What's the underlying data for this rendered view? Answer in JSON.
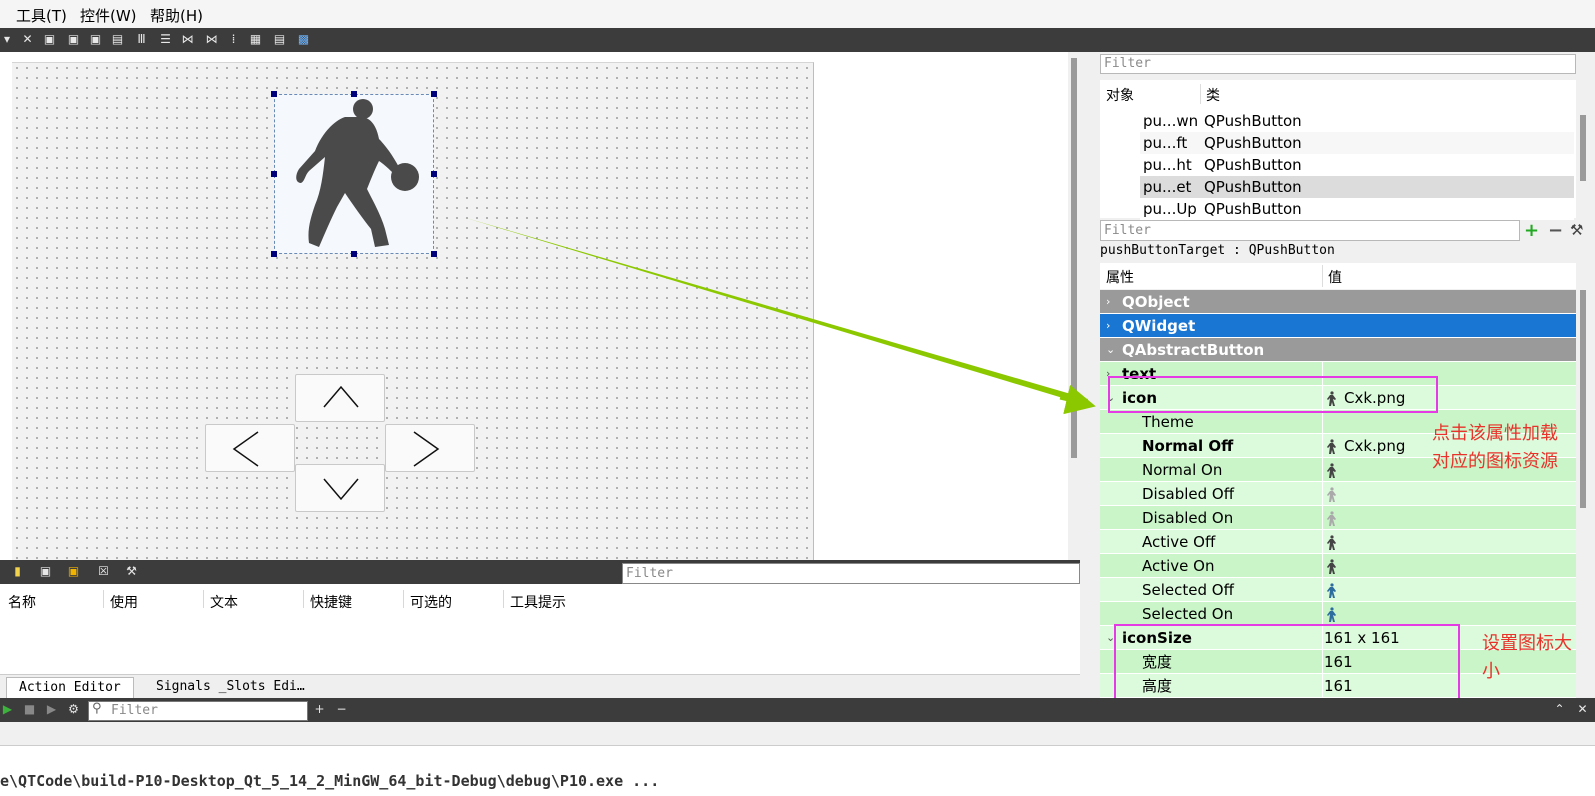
{
  "menu": {
    "items": [
      "工具(T)",
      "控件(W)",
      "帮助(H)"
    ]
  },
  "toolbar": {
    "icons": [
      "dropdown-icon",
      "break-layout-icon",
      "widget-editor-icon",
      "signal-slot-icon",
      "buddy-icon",
      "tab-order-icon",
      "layout-horizontal-icon",
      "layout-vertical-icon",
      "splitter-horizontal-icon",
      "splitter-vertical-icon",
      "layout-form-icon",
      "layout-grid-icon",
      "adjust-size-icon",
      "preview-icon"
    ]
  },
  "canvas": {
    "target_button_icon": "basketball-player-icon",
    "arrow_buttons": [
      "up-arrow-icon",
      "left-arrow-icon",
      "right-arrow-icon",
      "down-arrow-icon"
    ]
  },
  "object_inspector": {
    "filter_placeholder": "Filter",
    "col_object": "对象",
    "col_class": "类",
    "rows": [
      {
        "name": "pu...wn",
        "class": "QPushButton",
        "selected": false
      },
      {
        "name": "pu...ft",
        "class": "QPushButton",
        "selected": false
      },
      {
        "name": "pu...ht",
        "class": "QPushButton",
        "selected": false
      },
      {
        "name": "pu...et",
        "class": "QPushButton",
        "selected": true
      },
      {
        "name": "pu...Up",
        "class": "QPushButton",
        "selected": false
      }
    ]
  },
  "property_editor": {
    "filter_placeholder": "Filter",
    "object_label": "pushButtonTarget : QPushButton",
    "col_property": "属性",
    "col_value": "值",
    "rows": [
      {
        "key": "QObject",
        "value": "",
        "kind": "group",
        "color": "#9a9a9a"
      },
      {
        "key": "QWidget",
        "value": "",
        "kind": "group",
        "color": "#1976d2"
      },
      {
        "key": "QAbstractButton",
        "value": "",
        "kind": "group",
        "color": "#9a9a9a"
      },
      {
        "key": "text",
        "value": "",
        "kind": "prop-bold"
      },
      {
        "key": "icon",
        "value": "Cxk.png",
        "kind": "prop-bold"
      },
      {
        "key": "Theme",
        "value": "",
        "kind": "sub"
      },
      {
        "key": "Normal Off",
        "value": "Cxk.png",
        "kind": "sub-bold"
      },
      {
        "key": "Normal On",
        "value": "",
        "kind": "sub"
      },
      {
        "key": "Disabled Off",
        "value": "",
        "kind": "sub"
      },
      {
        "key": "Disabled On",
        "value": "",
        "kind": "sub"
      },
      {
        "key": "Active Off",
        "value": "",
        "kind": "sub"
      },
      {
        "key": "Active On",
        "value": "",
        "kind": "sub"
      },
      {
        "key": "Selected Off",
        "value": "",
        "kind": "sub"
      },
      {
        "key": "Selected On",
        "value": "",
        "kind": "sub"
      },
      {
        "key": "iconSize",
        "value": "161 x 161",
        "kind": "prop-bold"
      },
      {
        "key": "宽度",
        "value": "161",
        "kind": "sub"
      },
      {
        "key": "高度",
        "value": "161",
        "kind": "sub"
      }
    ]
  },
  "annotations": {
    "icon_note_line1": "点击该属性加载",
    "icon_note_line2": "对应的图标资源",
    "size_note_line1": "设置图标大",
    "size_note_line2": "小",
    "highlight_color": "#e43be4",
    "arrow_color": "#8cc800"
  },
  "action_editor": {
    "filter_placeholder": "Filter",
    "columns": [
      "名称",
      "使用",
      "文本",
      "快捷键",
      "可选的",
      "工具提示"
    ],
    "tabs": [
      "Action Editor",
      "Signals _Slots Edi…"
    ]
  },
  "run_pane": {
    "filter_placeholder": "Filter",
    "output_line": "e\\QTCode\\build-P10-Desktop_Qt_5_14_2_MinGW_64_bit-Debug\\debug\\P10.exe ..."
  }
}
